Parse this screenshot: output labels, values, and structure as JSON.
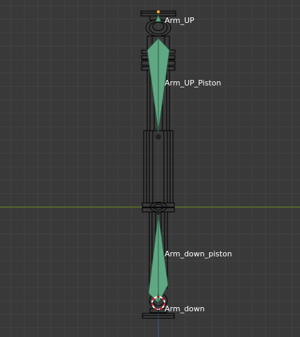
{
  "viewport": {
    "background_color": "#393939",
    "grid_minor_color": "#434343",
    "grid_major_color": "#4c4c4c",
    "x_axis_color": "#6e8f1e",
    "y_axis_color": "#3a6fa8",
    "wireframe_color": "#000000",
    "bone_fill_color": "#5fa883",
    "bone_edge_color": "#2e5c46",
    "cursor_color_a": "#ff2a2a",
    "cursor_color_b": "#ffffff"
  },
  "bones": [
    {
      "name": "Arm_UP"
    },
    {
      "name": "Arm_UP_Piston"
    },
    {
      "name": "Arm_down_piston"
    },
    {
      "name": "Arm_down"
    }
  ],
  "icons": {
    "cursor": "3d-cursor-icon",
    "origin": "object-origin-icon"
  }
}
